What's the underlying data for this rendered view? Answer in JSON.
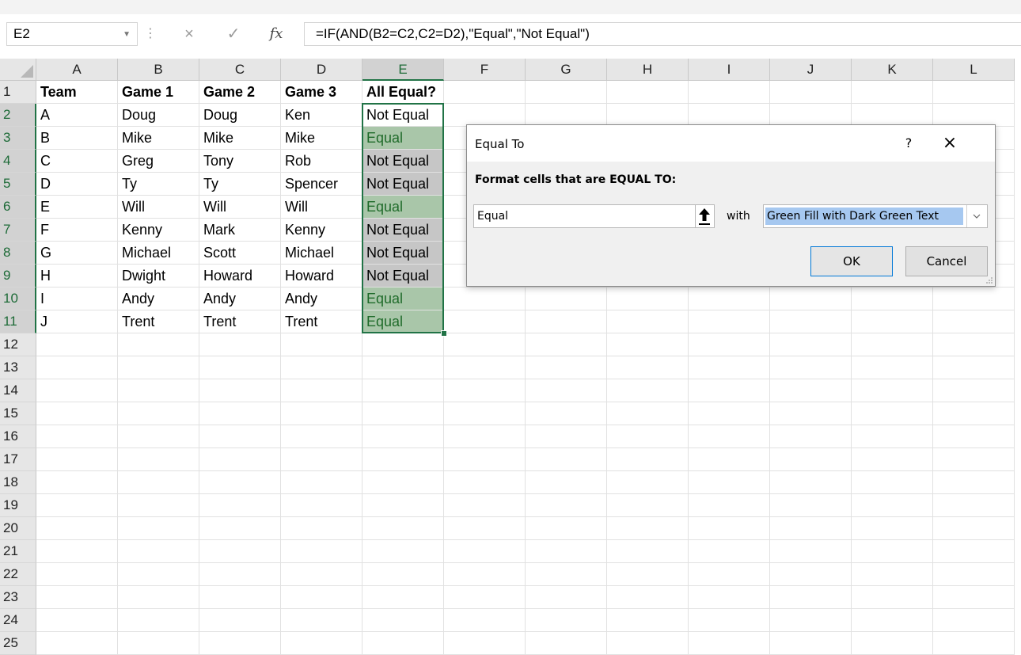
{
  "formula_bar": {
    "name_box": "E2",
    "cancel_icon": "×",
    "enter_icon": "✓",
    "fx_label": "fx",
    "formula": "=IF(AND(B2=C2,C2=D2),\"Equal\",\"Not Equal\")"
  },
  "grid": {
    "columns": [
      "A",
      "B",
      "C",
      "D",
      "E",
      "F",
      "G",
      "H",
      "I",
      "J",
      "K",
      "L"
    ],
    "selected_column": "E",
    "row_numbers": [
      "1",
      "2",
      "3",
      "4",
      "5",
      "6",
      "7",
      "8",
      "9",
      "10",
      "11",
      "12",
      "13",
      "14",
      "15",
      "16",
      "17",
      "18",
      "19",
      "20",
      "21",
      "22",
      "23",
      "24",
      "25"
    ],
    "header_row": [
      "Team",
      "Game 1",
      "Game 2",
      "Game 3",
      "All Equal?"
    ],
    "rows": [
      {
        "team": "A",
        "game1": "Doug",
        "game2": "Doug",
        "game3": "Ken",
        "result": "Not Equal",
        "highlight": "active"
      },
      {
        "team": "B",
        "game1": "Mike",
        "game2": "Mike",
        "game3": "Mike",
        "result": "Equal",
        "highlight": "equal"
      },
      {
        "team": "C",
        "game1": "Greg",
        "game2": "Tony",
        "game3": "Rob",
        "result": "Not Equal",
        "highlight": "not-equal"
      },
      {
        "team": "D",
        "game1": "Ty",
        "game2": "Ty",
        "game3": "Spencer",
        "result": "Not Equal",
        "highlight": "not-equal"
      },
      {
        "team": "E",
        "game1": "Will",
        "game2": "Will",
        "game3": "Will",
        "result": "Equal",
        "highlight": "equal"
      },
      {
        "team": "F",
        "game1": "Kenny",
        "game2": "Mark",
        "game3": "Kenny",
        "result": "Not Equal",
        "highlight": "not-equal"
      },
      {
        "team": "G",
        "game1": "Michael",
        "game2": "Scott",
        "game3": "Michael",
        "result": "Not Equal",
        "highlight": "not-equal"
      },
      {
        "team": "H",
        "game1": "Dwight",
        "game2": "Howard",
        "game3": "Howard",
        "result": "Not Equal",
        "highlight": "not-equal"
      },
      {
        "team": "I",
        "game1": "Andy",
        "game2": "Andy",
        "game3": "Andy",
        "result": "Equal",
        "highlight": "equal"
      },
      {
        "team": "J",
        "game1": "Trent",
        "game2": "Trent",
        "game3": "Trent",
        "result": "Equal",
        "highlight": "equal"
      }
    ]
  },
  "dialog": {
    "title": "Equal To",
    "help_label": "?",
    "close_label": "×",
    "prompt": "Format cells that are EQUAL TO:",
    "value": "Equal",
    "with_label": "with",
    "format_option": "Green Fill with Dark Green Text",
    "ok_label": "OK",
    "cancel_label": "Cancel"
  },
  "colors": {
    "accent": "#217346",
    "equal_fill": "#a9c6a9",
    "equal_text": "#1f6b2a",
    "not_equal_fill": "#c6c6c6",
    "header_bg": "#e6e6e6",
    "selection_highlight": "#a6c8f0"
  }
}
